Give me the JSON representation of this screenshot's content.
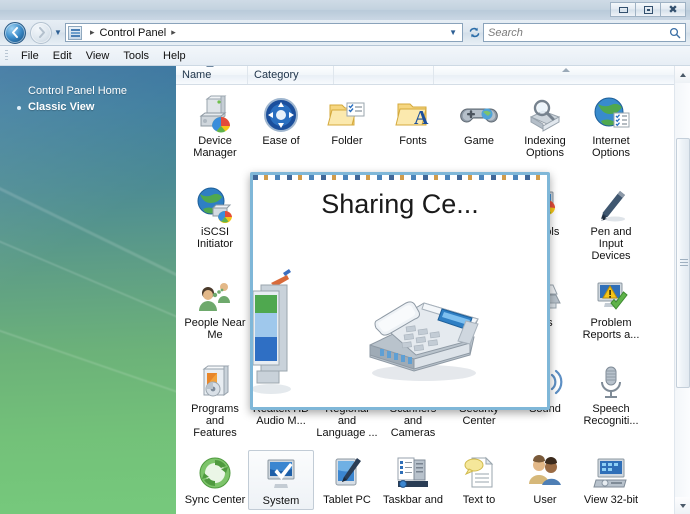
{
  "window": {
    "title": "Control Panel",
    "buttons": {
      "minimize": "minimize-button",
      "maximize": "maximize-button",
      "close": "close-button"
    }
  },
  "navbar": {
    "back": "←",
    "forward": "→",
    "history_caret": "▼",
    "address_caret": "▼",
    "refresh": "↻",
    "breadcrumb_sep": "▸",
    "crumb": "Control Panel",
    "address_icon": "control-panel-icon",
    "search_placeholder": "Search",
    "search_value": "",
    "search_icon": "⌕"
  },
  "menubar": {
    "items": [
      "File",
      "Edit",
      "View",
      "Tools",
      "Help"
    ]
  },
  "sidebar": {
    "items": [
      {
        "label": "Control Panel Home",
        "active": false,
        "bullet": false
      },
      {
        "label": "Classic View",
        "active": true,
        "bullet": true
      }
    ]
  },
  "columns": [
    {
      "label": "Name",
      "sorted": true
    },
    {
      "label": "Category",
      "sorted": false
    },
    {
      "label": "",
      "sorted": false
    },
    {
      "label": "",
      "sorted": false
    }
  ],
  "grid": {
    "rows": [
      [
        {
          "label": "Device Manager",
          "icon": "device-manager-icon"
        },
        {
          "label": "Ease of",
          "icon": "ease-of-access-icon"
        },
        {
          "label": "Folder",
          "icon": "folder-options-icon"
        },
        {
          "label": "Fonts",
          "icon": "fonts-icon"
        },
        {
          "label": "Game",
          "icon": "game-controllers-icon"
        },
        {
          "label": "Indexing Options",
          "icon": "indexing-options-icon"
        },
        {
          "label": "Internet Options",
          "icon": "internet-options-icon"
        }
      ],
      [
        {
          "label": "iSCSI Initiator",
          "icon": "iscsi-initiator-icon"
        },
        {
          "label": "",
          "icon": "hidden-icon"
        },
        {
          "label": "",
          "icon": "hidden-icon"
        },
        {
          "label": "",
          "icon": "hidden-icon"
        },
        {
          "label": "tal ols",
          "icon": "administrative-tools-icon"
        },
        {
          "label": "",
          "icon": "hidden-icon"
        },
        {
          "label": "Pen and Input Devices",
          "icon": "pen-input-devices-icon"
        }
      ],
      [
        {
          "label": "People Near Me",
          "icon": "people-near-me-icon"
        },
        {
          "label": "",
          "icon": "hidden-icon"
        },
        {
          "label": "",
          "icon": "hidden-icon"
        },
        {
          "label": "",
          "icon": "hidden-icon"
        },
        {
          "label": "ers",
          "icon": "printers-icon"
        },
        {
          "label": "",
          "icon": "hidden-icon"
        },
        {
          "label": "Problem Reports a...",
          "icon": "problem-reports-icon"
        }
      ],
      [
        {
          "label": "Programs and Features",
          "icon": "programs-features-icon"
        },
        {
          "label": "Realtek HD Audio M...",
          "icon": "realtek-audio-icon"
        },
        {
          "label": "Regional and Language ...",
          "icon": "regional-language-icon"
        },
        {
          "label": "Scanners and Cameras",
          "icon": "scanners-cameras-icon"
        },
        {
          "label": "Security Center",
          "icon": "security-center-icon"
        },
        {
          "label": "Sound",
          "icon": "sound-icon"
        },
        {
          "label": "Speech Recogniti...",
          "icon": "speech-recognition-icon"
        }
      ],
      [
        {
          "label": "Sync Center",
          "icon": "sync-center-icon"
        },
        {
          "label": "System",
          "icon": "system-icon",
          "selected": true
        },
        {
          "label": "Tablet PC",
          "icon": "tablet-pc-icon"
        },
        {
          "label": "Taskbar and",
          "icon": "taskbar-startmenu-icon"
        },
        {
          "label": "Text to",
          "icon": "text-to-speech-icon"
        },
        {
          "label": "User",
          "icon": "user-accounts-icon"
        },
        {
          "label": "View 32-bit",
          "icon": "view-32bit-icon"
        }
      ]
    ]
  },
  "overlay": {
    "title": "Sharing Ce...",
    "icon": "fax-machine-icon",
    "side_icon": "monitor-icon",
    "border_color": "#7fb7d8"
  },
  "scrollbar": {
    "up_arrow": "scroll-up-arrow",
    "down_arrow": "scroll-down-arrow",
    "thumb": "scroll-thumb"
  },
  "colors": {
    "accent": "#2a6ca8",
    "sidebar_top": "#336f9c",
    "sidebar_bottom": "#76c97c",
    "overlay_border": "#7fb7d8"
  }
}
